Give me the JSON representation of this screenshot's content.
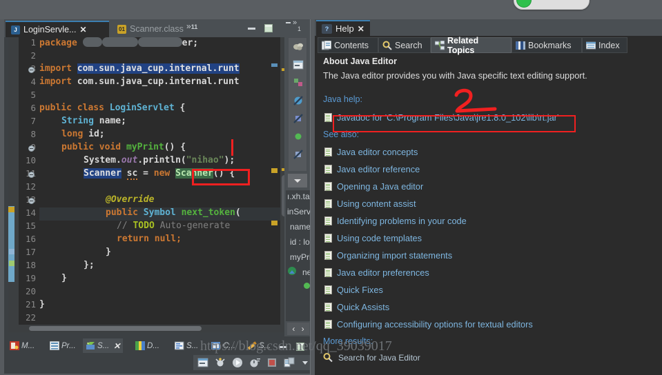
{
  "window": {
    "editor_tabs": [
      {
        "label": "LoginServle...",
        "icon": "java-file-icon",
        "active": true,
        "close": "✕"
      },
      {
        "label": "Scanner.class",
        "icon": "class-file-icon",
        "active": false
      }
    ],
    "tab_overflow": {
      "chevrons": "»",
      "count": "11"
    },
    "minimize": "–",
    "maximize": "▣",
    "mini_overflow": {
      "chevrons": "»",
      "count": "1"
    }
  },
  "code": {
    "lines": [
      {
        "n": "1",
        "fold": false
      },
      {
        "n": "2",
        "fold": false
      },
      {
        "n": "3",
        "fold": true
      },
      {
        "n": "4",
        "fold": false
      },
      {
        "n": "5",
        "fold": false
      },
      {
        "n": "6",
        "fold": false
      },
      {
        "n": "7",
        "fold": false
      },
      {
        "n": "8",
        "fold": false
      },
      {
        "n": "9",
        "fold": true
      },
      {
        "n": "10",
        "fold": false
      },
      {
        "n": "11",
        "fold": true
      },
      {
        "n": "12",
        "fold": false
      },
      {
        "n": "13",
        "fold": true
      },
      {
        "n": "14",
        "fold": false
      },
      {
        "n": "15",
        "fold": false
      },
      {
        "n": "16",
        "fold": false
      },
      {
        "n": "17",
        "fold": false
      },
      {
        "n": "18",
        "fold": false
      },
      {
        "n": "19",
        "fold": false
      },
      {
        "n": "20",
        "fold": false
      },
      {
        "n": "21",
        "fold": false
      },
      {
        "n": "22",
        "fold": false
      }
    ],
    "text": {
      "l1_kw": "package",
      "l1_tail": "er;",
      "l3_kw": "import",
      "l3_sel": "com.sun.java_cup.internal.runt",
      "l4_kw": "import",
      "l4_txt": "com.sun.java_cup.internal.runt",
      "l6": "public class LoginServlet {",
      "l6_kw1": "public",
      "l6_kw2": "class",
      "l6_cls": "LoginServlet",
      "l6_br": "{",
      "l7_type": "String",
      "l7_name": "name;",
      "l8_kw": "long",
      "l8_name": "id;",
      "l9_kw1": "public",
      "l9_kw2": "void",
      "l9_meth": "myPrint",
      "l9_tail": "() {",
      "l10_a": "System.",
      "l10_out": "out",
      "l10_b": ".println(",
      "l10_str": "\"nihao\"",
      "l10_c": ");",
      "l11_type": "Scanner",
      "l11_var": "sc",
      "l11_eq": " = ",
      "l11_new": "new",
      "l11_ctor": "Scanner",
      "l11_tail": "() {",
      "l13_anno": "@Override",
      "l14_kw": "public",
      "l14_type": "Symbol",
      "l14_meth": "next_token",
      "l14_tail": "(",
      "l15_cmt": "// ",
      "l15_todo": "TODO",
      "l15_cmt2": " Auto-generate",
      "l16_kw": "return",
      "l16_null": "null;",
      "l17": "}",
      "l18": "};",
      "l19": "}",
      "l21": "}"
    }
  },
  "outline": {
    "items": [
      "ı.xh.tac",
      "inServl",
      "name",
      "id : lo",
      "myPrin",
      "ne"
    ],
    "nav_prev": "‹",
    "nav_next": "›"
  },
  "bottom": {
    "tabs": [
      {
        "label": "M...",
        "icon": "markers-icon",
        "active": false
      },
      {
        "label": "Pr...",
        "icon": "properties-icon",
        "active": false
      },
      {
        "label": "S...",
        "icon": "servers-icon",
        "active": true,
        "close": "✕"
      },
      {
        "label": "D...",
        "icon": "data-source-icon",
        "active": false
      },
      {
        "label": "S...",
        "icon": "snippets-icon",
        "active": false
      },
      {
        "label": "C...",
        "icon": "console-icon",
        "active": false
      },
      {
        "label": "S...",
        "icon": "search-result-icon",
        "active": false
      }
    ],
    "minimize": "–",
    "maximize": "▣",
    "toolbar_icons": [
      "new-server-icon",
      "debug-icon",
      "start-icon",
      "profile-icon",
      "stop-icon",
      "publish-icon",
      "view-menu-icon"
    ]
  },
  "help": {
    "tab_label": "Help",
    "tab_icon": "help-icon",
    "tab_close": "✕",
    "toolbar": [
      {
        "label": "Contents",
        "icon": "contents-icon",
        "selected": false
      },
      {
        "label": "Search",
        "icon": "search-icon",
        "selected": false
      },
      {
        "label": "Related Topics",
        "icon": "related-topics-icon",
        "selected": true
      },
      {
        "label": "Bookmarks",
        "icon": "bookmarks-icon",
        "selected": false
      },
      {
        "label": "Index",
        "icon": "index-icon",
        "selected": false
      }
    ],
    "title": "About Java Editor",
    "description": "The Java editor provides you with Java specific text editing support.",
    "java_help_label": "Java help:",
    "javadoc_link": "Javadoc for 'C:\\Program Files\\Java\\jre1.8.0_102\\lib\\rt.jar'",
    "see_also_label": "See also:",
    "see_also_links": [
      "Java editor concepts",
      "Java editor reference",
      "Opening a Java editor",
      "Using content assist",
      "Identifying problems in your code",
      "Using code templates",
      "Organizing import statements",
      "Java editor preferences",
      "Quick Fixes",
      "Quick Assists",
      "Configuring accessibility options for textual editors"
    ],
    "more_results_label": "More results:",
    "more_results_link": "Search for Java Editor"
  },
  "watermark": "https://blog.csdn.net/qq_39039017",
  "colors": {
    "editor_bg": "#2b2b2b",
    "panel_bg": "#3c4043",
    "tabbar_bg": "#4a4f53",
    "link_blue": "#7eb6e0",
    "label_blue": "#5b9bd5",
    "annotation_red": "#f02020",
    "keyword_orange": "#cc7832",
    "class_blue": "#5fb3d4",
    "method_green": "#54b33e",
    "string_green": "#6a8759"
  }
}
